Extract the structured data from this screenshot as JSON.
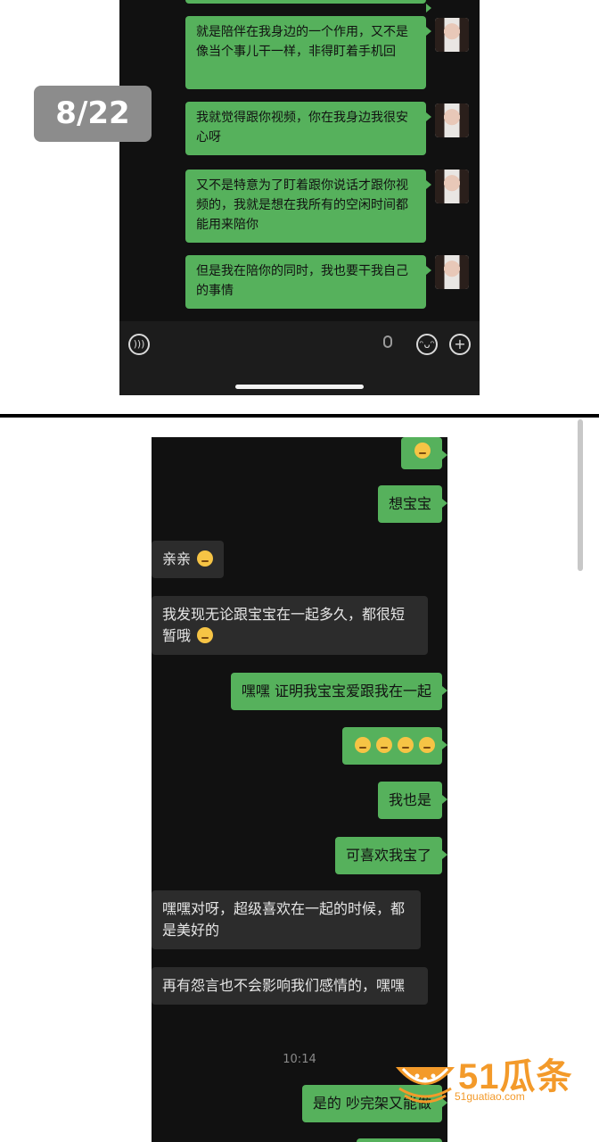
{
  "page_badge": "8/22",
  "top_chat": {
    "messages": [
      "就是陪伴在我身边的一个作用，又不是像当个事儿干一样，非得盯着手机回",
      "我就觉得跟你视频，你在我身边我很安心呀",
      "又不是特意为了盯着跟你说话才跟你视频的，我就是想在我所有的空闲时间都能用来陪你",
      "但是我在陪你的同时，我也要干我自己的事情"
    ],
    "input_icons": [
      "voice-icon",
      "microphone-icon",
      "emoji-icon",
      "plus-icon"
    ]
  },
  "bottom_chat": {
    "messages": [
      {
        "side": "right",
        "text": "想宝宝"
      },
      {
        "side": "left",
        "text": "亲亲"
      },
      {
        "side": "left",
        "text": "我发现无论跟宝宝在一起多久，都很短暂哦"
      },
      {
        "side": "right",
        "text": "嘿嘿 证明我宝宝爱跟我在一起"
      },
      {
        "side": "right",
        "text": "😚😚😚😚"
      },
      {
        "side": "right",
        "text": "我也是"
      },
      {
        "side": "right",
        "text": "可喜欢我宝了"
      },
      {
        "side": "left",
        "text": "嘿嘿对呀，超级喜欢在一起的时候，都是美好的"
      },
      {
        "side": "left",
        "text": "再有怨言也不会影响我们感情的，嘿嘿"
      },
      {
        "side": "right",
        "text": "是的 吵完架又能做"
      }
    ],
    "timestamp": "10:14"
  },
  "watermark": {
    "brand": "51瓜条",
    "url": "51guatiao.com"
  }
}
